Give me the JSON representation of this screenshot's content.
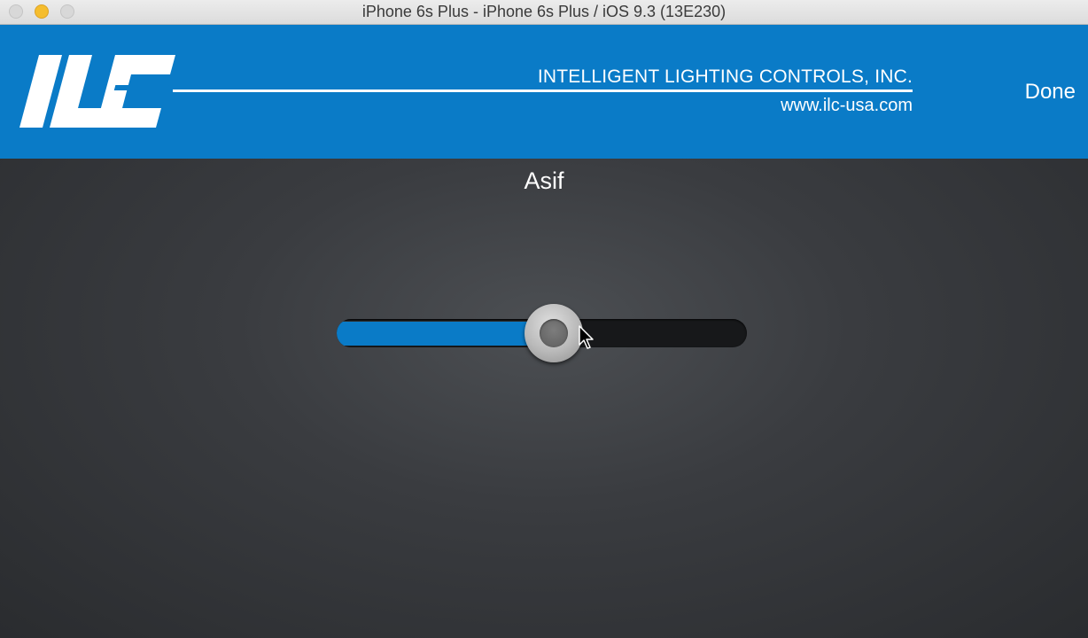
{
  "window": {
    "title": "iPhone 6s Plus - iPhone 6s Plus / iOS 9.3 (13E230)"
  },
  "header": {
    "logo_text": "ILC",
    "company_name": "INTELLIGENT LIGHTING CONTROLS, INC.",
    "company_url": "www.ilc-usa.com",
    "done_label": "Done",
    "accent_color": "#0a7bc7"
  },
  "main": {
    "load_name": "Asif",
    "dimmer": {
      "level": 0.53,
      "fill_color": "#0a7bc7"
    }
  },
  "icons": {
    "close": "close-window-icon",
    "minimize": "minimize-window-icon",
    "maximize": "maximize-window-icon",
    "cursor": "mouse-pointer-icon"
  }
}
